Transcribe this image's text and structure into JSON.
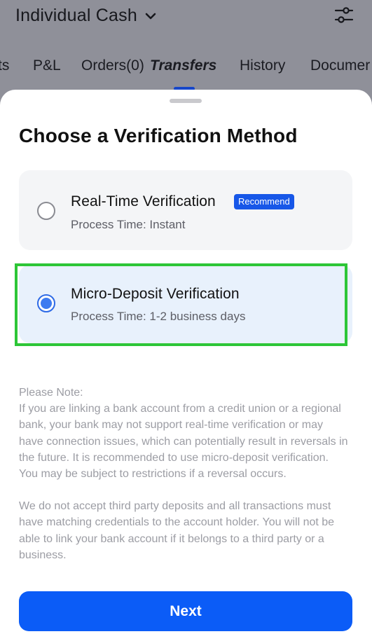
{
  "header": {
    "account_name": "Individual Cash"
  },
  "tabs": [
    {
      "label": "ts"
    },
    {
      "label": "P&L"
    },
    {
      "label": "Orders(0)"
    },
    {
      "label": "Transfers"
    },
    {
      "label": "History"
    },
    {
      "label": "Documer"
    }
  ],
  "active_tab": "Transfers",
  "sheet": {
    "title": "Choose a Verification Method",
    "options": [
      {
        "title": "Real-Time Verification",
        "badge": "Recommend",
        "subtitle": "Process Time: Instant",
        "selected": false
      },
      {
        "title": "Micro-Deposit Verification",
        "subtitle": "Process Time: 1-2 business days",
        "selected": true
      }
    ],
    "note_paragraph_1": "Please Note:\nIf you are linking a bank account from a credit union or a regional bank, your bank may not support real-time verification or may have connection issues, which can potentially result in reversals in the future. It is recommended to use micro-deposit verification. You may be subject to restrictions if a reversal occurs.",
    "note_paragraph_2": "We do not accept third party deposits and all transactions must have matching credentials to the account holder. You will not be able to link your bank account if it belongs to a third party or a business.",
    "next_label": "Next"
  },
  "colors": {
    "accent": "#0b5cf7",
    "badge": "#1757e8",
    "selected_bg": "#e8f1fc",
    "highlight_border": "#2dc637",
    "dim_overlay": "#8f9099"
  },
  "icons": {
    "dropdown": "chevron-down-icon",
    "filter": "sliders-icon"
  }
}
